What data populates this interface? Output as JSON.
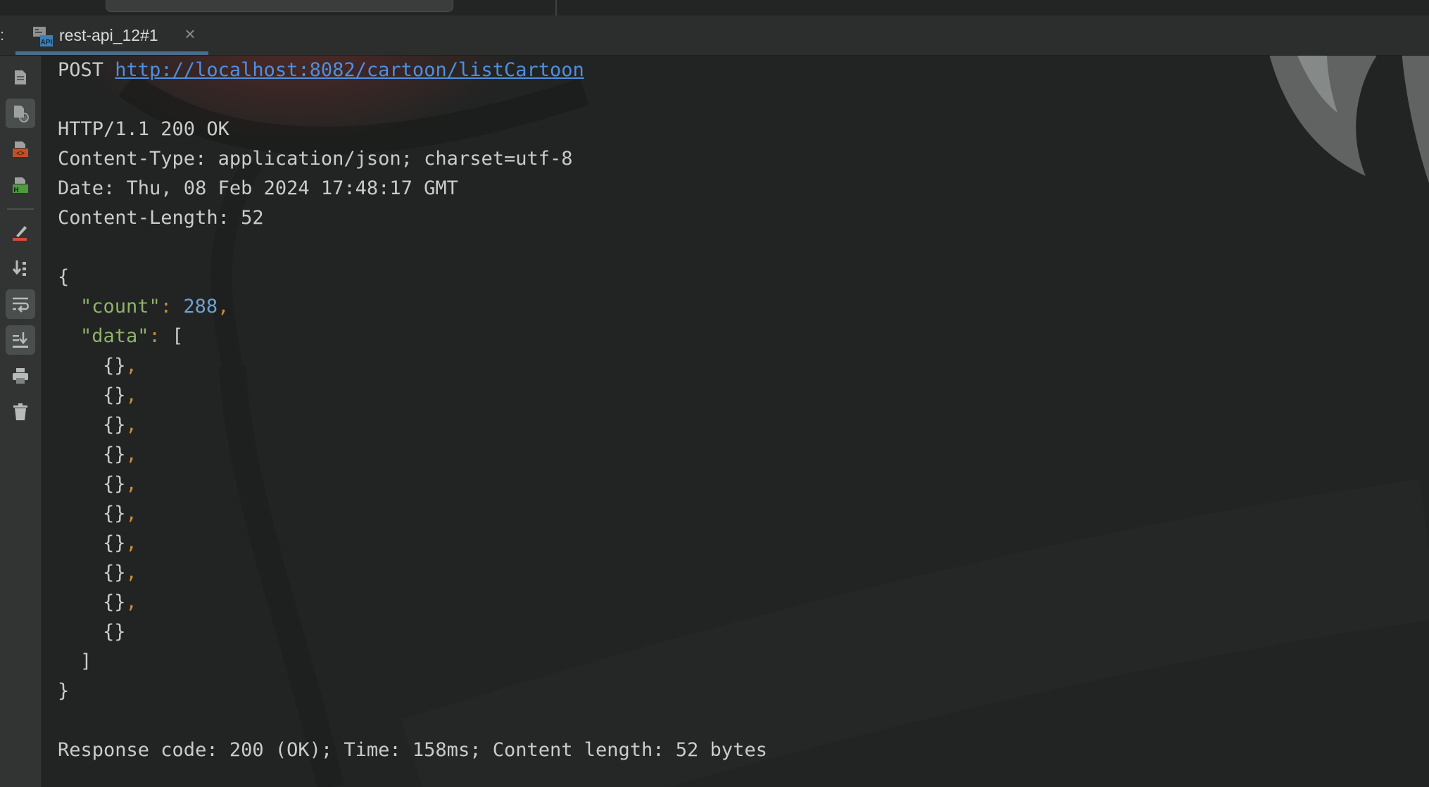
{
  "tab": {
    "label": "rest-api_12#1",
    "icon": "api-file-icon",
    "close": "×"
  },
  "toolbar": {
    "buttons": [
      "document-icon",
      "api-document-icon",
      "html-document-icon",
      "h-document-icon",
      "clear-brush-icon",
      "sort-down-icon",
      "soft-wrap-icon",
      "scroll-to-end-icon",
      "print-icon",
      "trash-icon"
    ],
    "active": [
      "api-document-icon",
      "soft-wrap-icon",
      "scroll-to-end-icon"
    ]
  },
  "request": {
    "method": "POST",
    "url": "http://localhost:8082/cartoon/listCartoon"
  },
  "response_headers": {
    "status_line": "HTTP/1.1 200 OK",
    "content_type": "Content-Type: application/json; charset=utf-8",
    "date": "Date: Thu, 08 Feb 2024 17:48:17 GMT",
    "content_length": "Content-Length: 52"
  },
  "body": {
    "open_brace": "{",
    "count_key": "\"count\"",
    "count_value": "288",
    "data_key": "\"data\"",
    "data_open": "[",
    "items": [
      "{}",
      "{}",
      "{}",
      "{}",
      "{}",
      "{}",
      "{}",
      "{}",
      "{}",
      "{}"
    ],
    "data_close": "]",
    "close_brace": "}"
  },
  "summary": "Response code: 200 (OK); Time: 158ms; Content length: 52 bytes",
  "colors": {
    "url": "#4f8fe0",
    "json_key": "#8fb36a",
    "json_number": "#6ea0cf",
    "json_punctuation": "#cc8a3c",
    "text": "#c8ccca"
  }
}
